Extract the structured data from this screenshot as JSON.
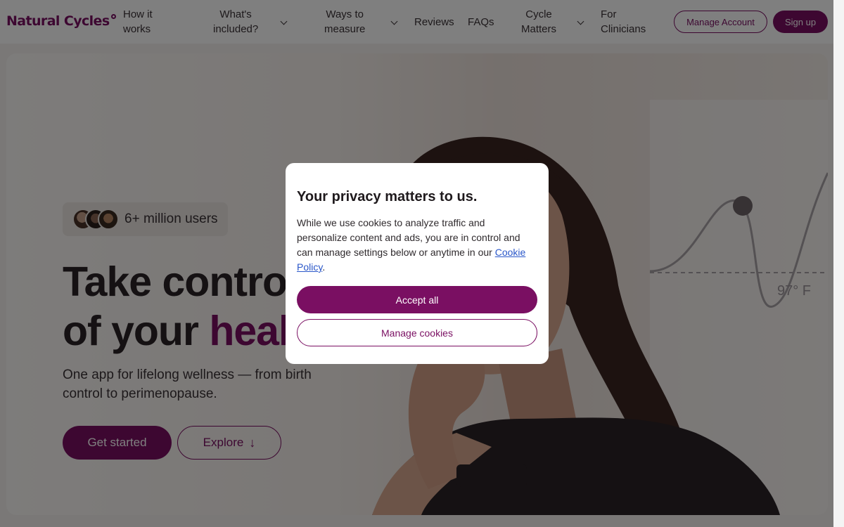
{
  "nav": {
    "logo": "Natural Cycles",
    "items": [
      {
        "label_line1": "How it",
        "label_line2": "works"
      },
      {
        "label_line1": "What's",
        "label_line2": "included?"
      },
      {
        "label_line1": "Ways to",
        "label_line2": "measure"
      },
      {
        "label": "Reviews"
      },
      {
        "label": "FAQs"
      },
      {
        "label_line1": "Cycle",
        "label_line2": "Matters"
      },
      {
        "label_line1": "For",
        "label_line2": "Clinicians"
      }
    ],
    "manage_account": "Manage Account",
    "sign_up": "Sign up"
  },
  "hero": {
    "users_badge": "6+ million users",
    "headline_line1": "Take control",
    "headline_line2_plain": "of your ",
    "headline_line2_accent": "health",
    "subtitle": "One app for lifelong wellness — from birth control to perimenopause.",
    "cta_primary": "Get started",
    "cta_secondary": "Explore",
    "temperature_label": "97° F"
  },
  "cookie_modal": {
    "title": "Your privacy matters to us.",
    "body_text": "While we use cookies to analyze traffic and personalize content and ads, you are in control and can manage settings below or anytime in our ",
    "link_text": "Cookie Policy",
    "body_end": ".",
    "accept_label": "Accept all",
    "manage_label": "Manage cookies"
  },
  "colors": {
    "brand": "#7a0f62",
    "link": "#2a57c9"
  }
}
